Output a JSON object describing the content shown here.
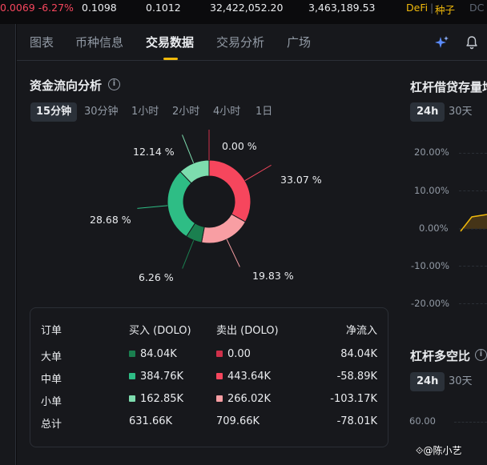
{
  "ticker": {
    "change": "0.0069 -6.27%",
    "high": "0.1098",
    "low": "0.1012",
    "vol_token": "32,422,052.20",
    "vol_quote": "3,463,189.53",
    "tag1": "DeFi",
    "tag2": "种子",
    "tag3": "DC"
  },
  "tabs": [
    "图表",
    "币种信息",
    "交易数据",
    "交易分析",
    "广场"
  ],
  "money_flow": {
    "title": "资金流向分析",
    "timeframes": [
      "15分钟",
      "30分钟",
      "1小时",
      "2小时",
      "4小时",
      "1日"
    ],
    "donut_labels": {
      "large_buy": "0.00 %",
      "large_sell": "33.07 %",
      "medium_buy": "19.83 %",
      "medium_sell": "6.26 %",
      "small_buy": "28.68 %",
      "small_sell": "12.14 %"
    },
    "colors": {
      "large_buy": "#1a7f4f",
      "medium_buy": "#2ebd85",
      "small_buy": "#7ddcae",
      "large_sell": "#cf304a",
      "medium_sell": "#f6465d",
      "small_sell": "#f89ea3"
    }
  },
  "chart_data": {
    "type": "pie",
    "categories": [
      "大单卖出",
      "中单卖出",
      "小单卖出",
      "大单买入",
      "中单买入",
      "小单买入"
    ],
    "values": [
      0.0,
      33.07,
      19.83,
      6.26,
      28.68,
      12.14
    ],
    "title": "",
    "unit": "%"
  },
  "table": {
    "headers": [
      "订单",
      "买入 (DOLO)",
      "卖出 (DOLO)",
      "净流入"
    ],
    "rows": [
      {
        "name": "大单",
        "buy": "84.04K",
        "sell": "0.00",
        "net": "84.04K"
      },
      {
        "name": "中单",
        "buy": "384.76K",
        "sell": "443.64K",
        "net": "-58.89K"
      },
      {
        "name": "小单",
        "buy": "162.85K",
        "sell": "266.02K",
        "net": "-103.17K"
      },
      {
        "name": "总计",
        "buy": "631.66K",
        "sell": "709.66K",
        "net": "-78.01K"
      }
    ]
  },
  "margin_loan": {
    "title": "杠杆借贷存量增",
    "buttons": [
      "24h",
      "30天"
    ],
    "yticks": [
      "20.00%",
      "10.00%",
      "0.00%",
      "-10.00%",
      "-20.00%"
    ]
  },
  "long_short": {
    "title": "杠杆多空比",
    "buttons": [
      "24h",
      "30天"
    ],
    "ytick": "60.00"
  },
  "watermark": "@陈小艺"
}
